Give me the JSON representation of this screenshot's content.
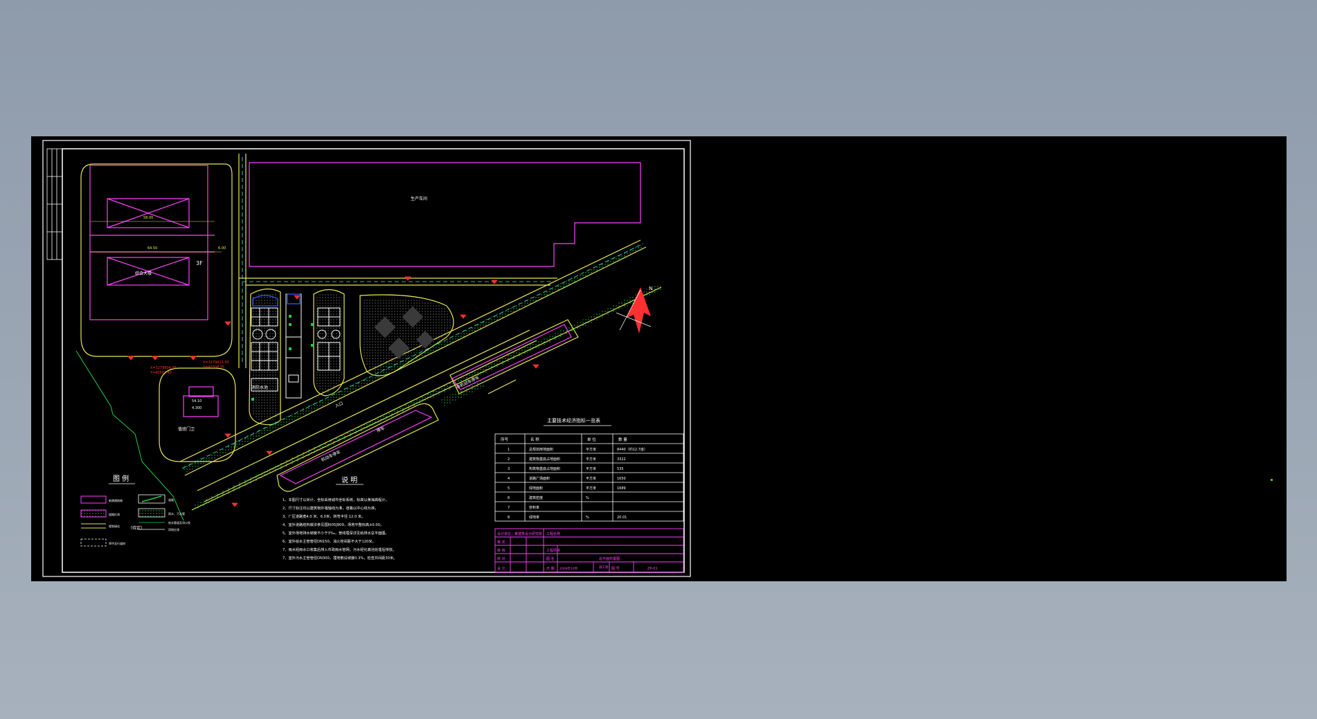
{
  "colors": {
    "background": "#000000",
    "frame": "#ffffff",
    "building": "#ff40ff",
    "road": "#e8e850",
    "green": "#22cc44",
    "cyan": "#55e6e6",
    "red": "#ff3030",
    "blue": "#3355ff"
  },
  "site": {
    "production_area": "生产车间",
    "office_building": "综合大楼",
    "office_floors": "3F",
    "office_dim_a": "58.00",
    "office_dim_b": "64.50",
    "office_dim_c": "6.00",
    "guard_house": "值班门卫",
    "guard_elev_a": "54.10",
    "guard_elev_b": "4.300",
    "pump_house": "消防水池",
    "coord_1a": "X=3279604.86",
    "coord_1b": "Y=40503.42",
    "coord_2a": "X=3279621.45",
    "coord_2b": "Y=40508.35",
    "parking_1": "机动车停车",
    "parking_2": "非机动车停车",
    "parking_3": "停车",
    "road_label": "入口",
    "north": "N"
  },
  "legend": {
    "title": "图  例",
    "items": [
      "新建建筑物",
      "道路红线",
      "规划绿化",
      "草坪及行道树",
      "道路",
      "雨水、污水管",
      "（待定）",
      "给水管道及消火栓",
      "用地红线"
    ]
  },
  "notes": {
    "title": "说  明",
    "lines": [
      "1、本图尺寸以米计，坐标采用城市坐标系统，标高以黄海高程计。",
      "2、尺寸标注均以建筑物外墙轴线为准，道路以中心线为准。",
      "3、厂区道路宽4.0 米、6.0米，转弯半径 12.0 米。",
      "4、室外道路结构做法参见国标05J909，场地平整标高±0.00。",
      "5、室外场地排水坡度不小于3‰，管线埋深详见给排水总平面图。",
      "6、室外给水主管管径DN150，消火栓间距不大于120米。",
      "7、雨水经雨水口收集后排入市政雨水管网，污水经化粪池处理后排放。",
      "7、室外污水主管管径DN300，埋地敷设坡度0.3%，检查井间距30米。"
    ]
  },
  "indicator_table": {
    "title": "主要技术经济指标一览表",
    "headers": [
      "序号",
      "名  称",
      "单 位",
      "数  量"
    ],
    "rows": [
      [
        "1",
        "总规划用地面积",
        "平方米",
        "8440（约12.7亩）"
      ],
      [
        "2",
        "建筑物基底占地面积",
        "平方米",
        "3322"
      ],
      [
        "3",
        "构筑物基底占地面积",
        "平方米",
        "535"
      ],
      [
        "4",
        "道路广场面积",
        "平方米",
        "1650"
      ],
      [
        "5",
        "绿地面积",
        "平方米",
        "1689"
      ],
      [
        "6",
        "建筑密度",
        "%",
        ""
      ],
      [
        "7",
        "容积率",
        "",
        ""
      ],
      [
        "8",
        "绿地率",
        "%",
        "20.01"
      ]
    ]
  },
  "title_block": {
    "design_unit": "设计单位：某建筑设计研究院",
    "project": "工程名称",
    "sub_project": "工程项目",
    "drawing_name_label": "图 名",
    "drawing_name": "总平面布置图",
    "date_label": "日 期",
    "date": "2009年10月",
    "drawing_no_label": "图 号",
    "drawing_no": "ZP-01",
    "rows": [
      "审 定",
      "审 核",
      "校 对",
      "设 计"
    ],
    "stage": "施工图"
  }
}
